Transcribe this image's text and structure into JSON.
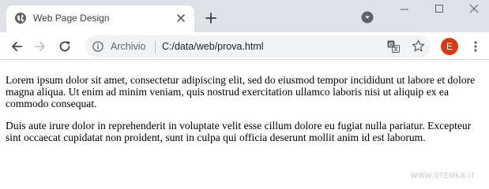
{
  "browser": {
    "tab": {
      "title": "Web Page Design",
      "favicon": "globe-icon"
    },
    "omnibox": {
      "chip": "Archivio",
      "url": "C:/data/web/prova.html"
    },
    "profile": {
      "initial": "E",
      "color": "#d63c12"
    }
  },
  "page": {
    "paragraphs": [
      "Lorem ipsum dolor sit amet, consectetur adipiscing elit, sed do eiusmod tempor incididunt ut labore et dolore magna aliqua. Ut enim ad minim veniam, quis nostrud exercitation ullamco laboris nisi ut aliquip ex ea commodo consequat.",
      "Duis aute irure dolor in reprehenderit in voluptate velit esse cillum dolore eu fugiat nulla pariatur. Excepteur sint occaecat cupidatat non proident, sunt in culpa qui officia deserunt mollit anim id est laborum."
    ]
  },
  "watermark": "WWW.STEMKB.IT"
}
